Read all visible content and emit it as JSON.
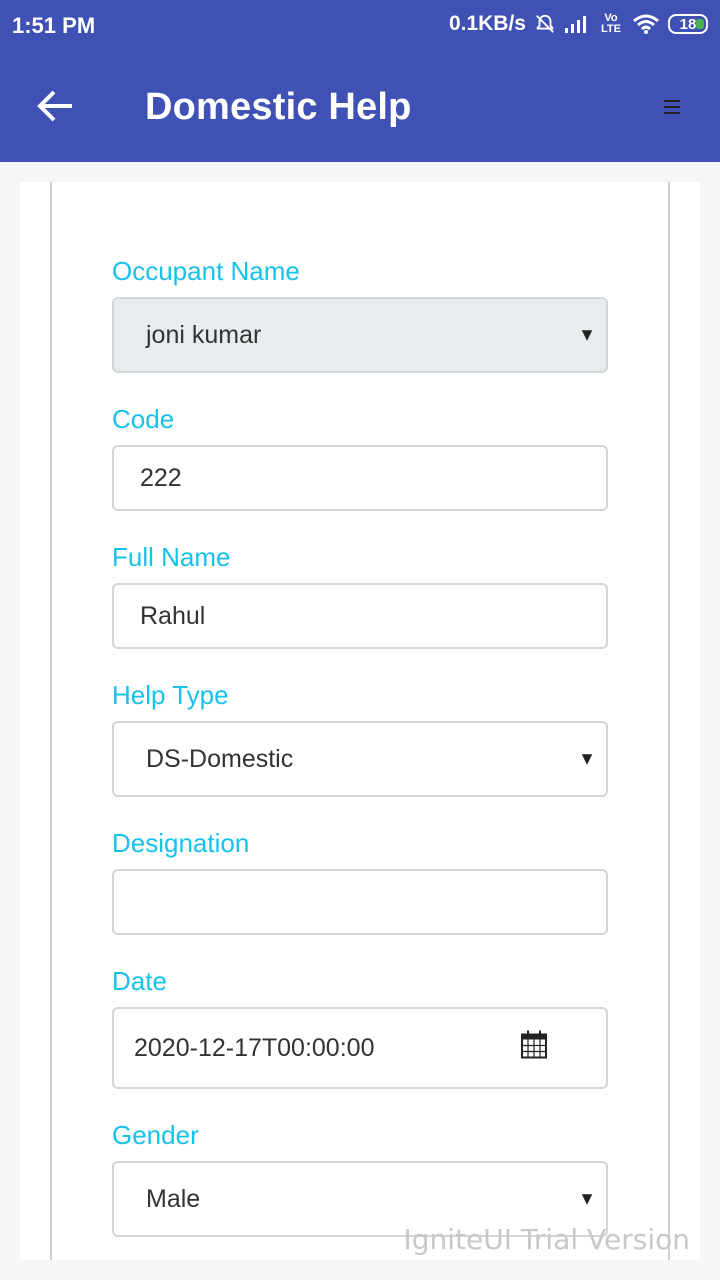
{
  "status_bar": {
    "time": "1:51 PM",
    "network_speed": "0.1KB/s",
    "volte_label": "Vo LTE",
    "battery_level": "18",
    "icons": [
      "alarm-off-icon",
      "signal-icon",
      "volte-icon",
      "wifi-icon",
      "battery-icon"
    ]
  },
  "app_bar": {
    "title": "Domestic Help",
    "back_icon": "arrow-left-icon",
    "menu_icon": "menu-icon"
  },
  "form": {
    "occupant_name": {
      "label": "Occupant Name",
      "value": "joni kumar"
    },
    "code": {
      "label": "Code",
      "value": "222"
    },
    "full_name": {
      "label": "Full Name",
      "value": "Rahul"
    },
    "help_type": {
      "label": "Help Type",
      "value": "DS-Domestic"
    },
    "designation": {
      "label": "Designation",
      "value": ""
    },
    "date": {
      "label": "Date",
      "value": "2020-12-17T00:00:00"
    },
    "gender": {
      "label": "Gender",
      "value": "Male"
    }
  },
  "watermark": "IgniteUI Trial Version",
  "colors": {
    "primary": "#3f51b5",
    "label": "#17c2ea",
    "field_border": "#d3d6d9",
    "disabled_bg": "#e9ecef"
  }
}
